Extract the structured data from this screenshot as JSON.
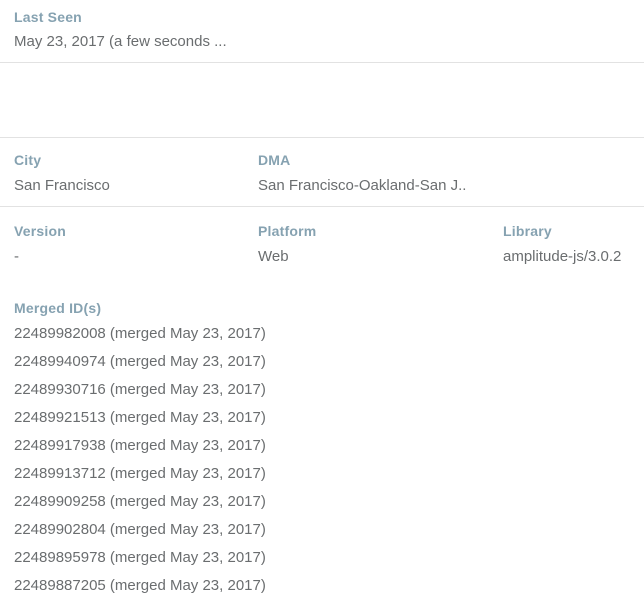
{
  "colors": {
    "label": "#86a2b1",
    "value": "#6a6d6f",
    "divider": "#e2e2e2",
    "background": "#ffffff"
  },
  "last_seen": {
    "label": "Last Seen",
    "value": "May 23, 2017 (a few seconds ..."
  },
  "location": {
    "city": {
      "label": "City",
      "value": "San Francisco"
    },
    "dma": {
      "label": "DMA",
      "value": "San Francisco-Oakland-San J.."
    }
  },
  "device": {
    "version": {
      "label": "Version",
      "value": "-"
    },
    "platform": {
      "label": "Platform",
      "value": "Web"
    },
    "library": {
      "label": "Library",
      "value": "amplitude-js/3.0.2"
    }
  },
  "merged": {
    "label": "Merged ID(s)",
    "ids": [
      "22489982008 (merged May 23, 2017)",
      "22489940974 (merged May 23, 2017)",
      "22489930716 (merged May 23, 2017)",
      "22489921513 (merged May 23, 2017)",
      "22489917938 (merged May 23, 2017)",
      "22489913712 (merged May 23, 2017)",
      "22489909258 (merged May 23, 2017)",
      "22489902804 (merged May 23, 2017)",
      "22489895978 (merged May 23, 2017)",
      "22489887205 (merged May 23, 2017)"
    ]
  }
}
